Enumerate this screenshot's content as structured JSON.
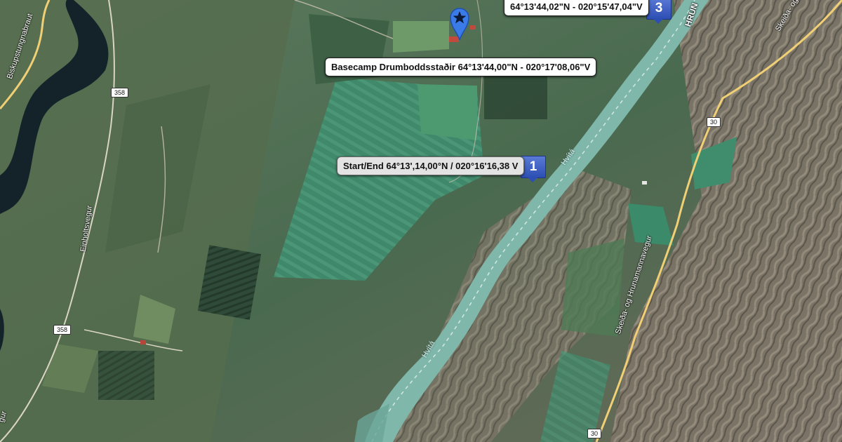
{
  "colors": {
    "terrain": "#4f6a50",
    "river": "#7fb7aa",
    "road": "#f0cf75",
    "pin": "#3b7be8",
    "marker": "#2d4fb3"
  },
  "labels": {
    "basecamp": "Basecamp Drumboddsstaðir 64°13'44,00\"N - 020°17'08,06\"V",
    "start_end": "Start/End 64°13',14,00°N / 020°16'16,38 V",
    "waypoint_3": "64°13'44,02\"N - 020°15'47,04\"V"
  },
  "markers": {
    "m1": "1",
    "m3": "3",
    "pin_icon": "star-pin-icon"
  },
  "roads": {
    "r358a": "358",
    "r358b": "358",
    "r30a": "30",
    "r30b": "30",
    "biskupstungnabraut": "Biskupstungnabraut",
    "einholtsvegur": "Einholtsvegur",
    "skeida": "Skeiða- og Hrunamannavegur",
    "skeida_top": "Skeiða- og",
    "hrun": "HRUN",
    "edge_left": "gur"
  },
  "rivers": {
    "hvita_upper": "Hvítá",
    "hvita_lower": "Hvítá"
  }
}
